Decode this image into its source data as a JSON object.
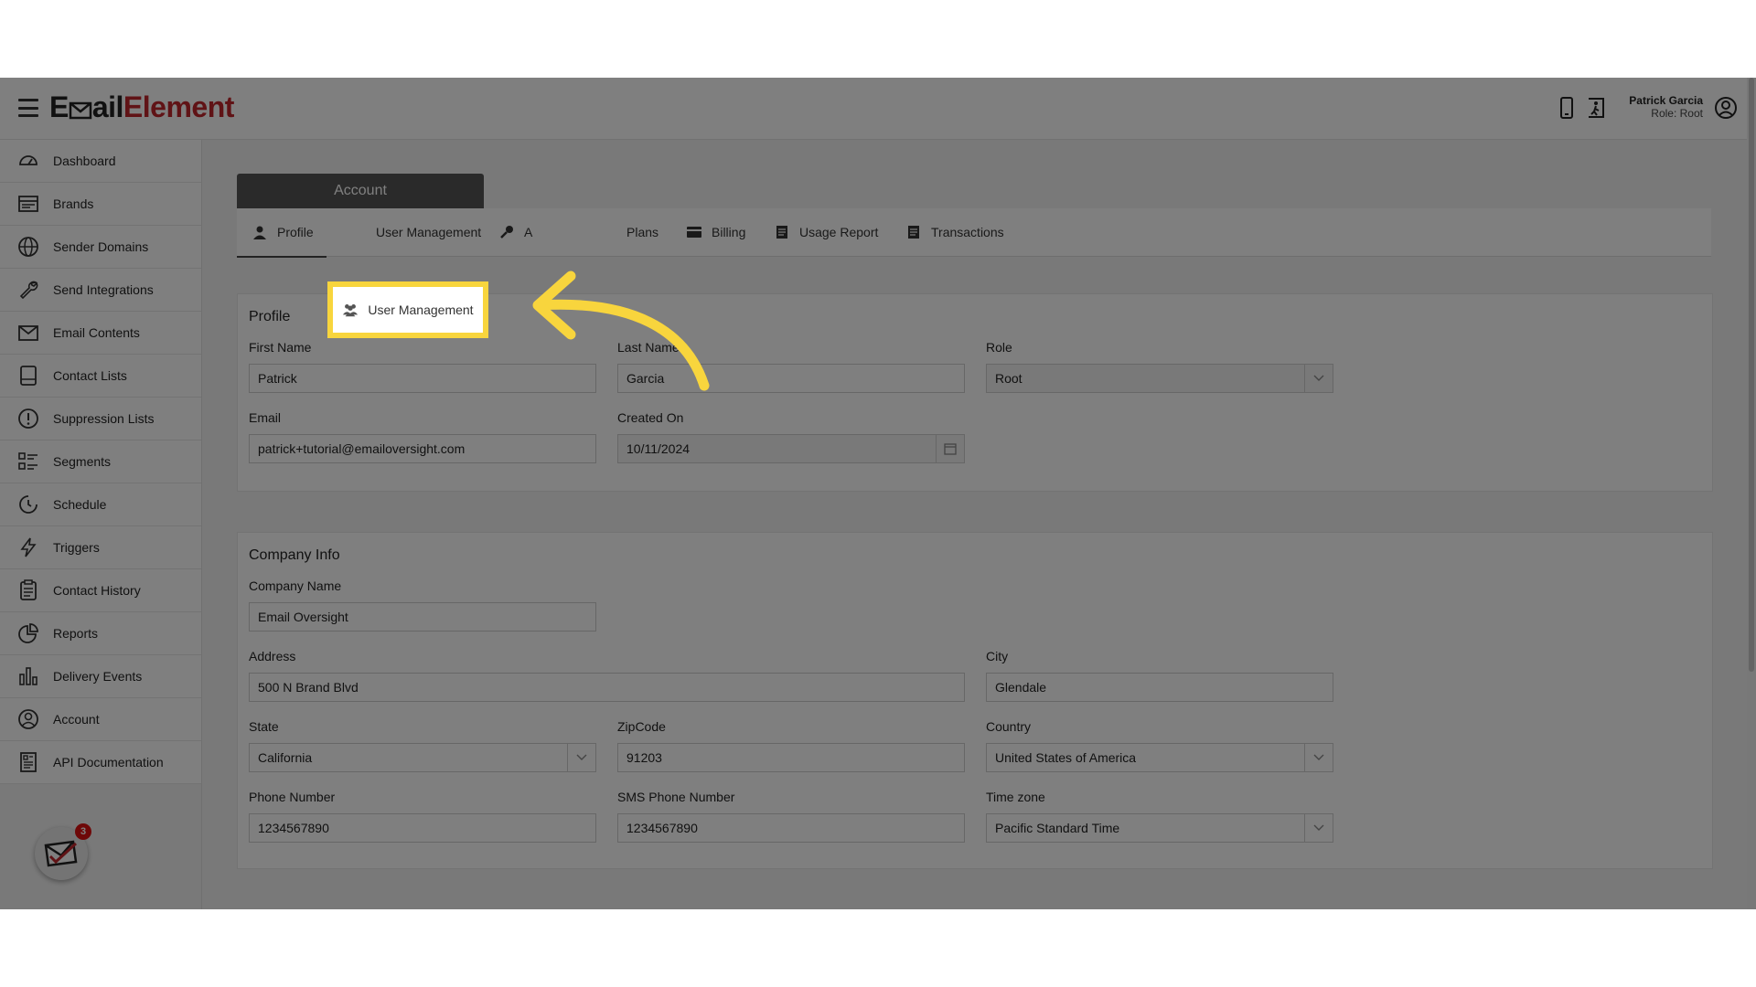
{
  "header": {
    "logo_prefix": "E",
    "logo_middle": "ail",
    "logo_suffix": "Element",
    "user_name": "Patrick Garcia",
    "user_role": "Role: Root"
  },
  "sidebar": {
    "items": [
      {
        "label": "Dashboard",
        "icon": "dashboard-icon"
      },
      {
        "label": "Brands",
        "icon": "brands-icon"
      },
      {
        "label": "Sender Domains",
        "icon": "globe-icon"
      },
      {
        "label": "Send Integrations",
        "icon": "wrench-icon"
      },
      {
        "label": "Email Contents",
        "icon": "envelope-icon"
      },
      {
        "label": "Contact Lists",
        "icon": "list-icon"
      },
      {
        "label": "Suppression Lists",
        "icon": "alert-icon"
      },
      {
        "label": "Segments",
        "icon": "segments-icon"
      },
      {
        "label": "Schedule",
        "icon": "clock-icon"
      },
      {
        "label": "Triggers",
        "icon": "bolt-icon"
      },
      {
        "label": "Contact History",
        "icon": "clipboard-icon"
      },
      {
        "label": "Reports",
        "icon": "pie-chart-icon"
      },
      {
        "label": "Delivery Events",
        "icon": "bar-chart-icon"
      },
      {
        "label": "Account",
        "icon": "user-circle-icon"
      },
      {
        "label": "API Documentation",
        "icon": "document-icon"
      }
    ],
    "notification_count": "3"
  },
  "account": {
    "section_tab": "Account",
    "tabs": [
      {
        "label": "Profile",
        "icon": "person-icon"
      },
      {
        "label": "User Management",
        "icon": "users-icon"
      },
      {
        "label": "A",
        "icon": "key-icon"
      },
      {
        "label": "Plans",
        "icon": "plans-icon"
      },
      {
        "label": "Billing",
        "icon": "card-icon"
      },
      {
        "label": "Usage Report",
        "icon": "report-icon"
      },
      {
        "label": "Transactions",
        "icon": "transactions-icon"
      }
    ]
  },
  "profile": {
    "title": "Profile",
    "first_name_label": "First Name",
    "first_name": "Patrick",
    "last_name_label": "Last Name",
    "last_name": "Garcia",
    "role_label": "Role",
    "role": "Root",
    "email_label": "Email",
    "email": "patrick+tutorial@emailoversight.com",
    "created_on_label": "Created On",
    "created_on": "10/11/2024"
  },
  "company": {
    "title": "Company Info",
    "company_name_label": "Company Name",
    "company_name": "Email Oversight",
    "address_label": "Address",
    "address": "500 N Brand Blvd",
    "city_label": "City",
    "city": "Glendale",
    "state_label": "State",
    "state": "California",
    "zip_label": "ZipCode",
    "zip": "91203",
    "country_label": "Country",
    "country": "United States of America",
    "phone_label": "Phone Number",
    "phone": "1234567890",
    "sms_label": "SMS Phone Number",
    "sms": "1234567890",
    "timezone_label": "Time zone",
    "timezone": "Pacific Standard Time"
  },
  "colors": {
    "highlight": "#f8d53d",
    "brand_red": "#c0262c"
  }
}
